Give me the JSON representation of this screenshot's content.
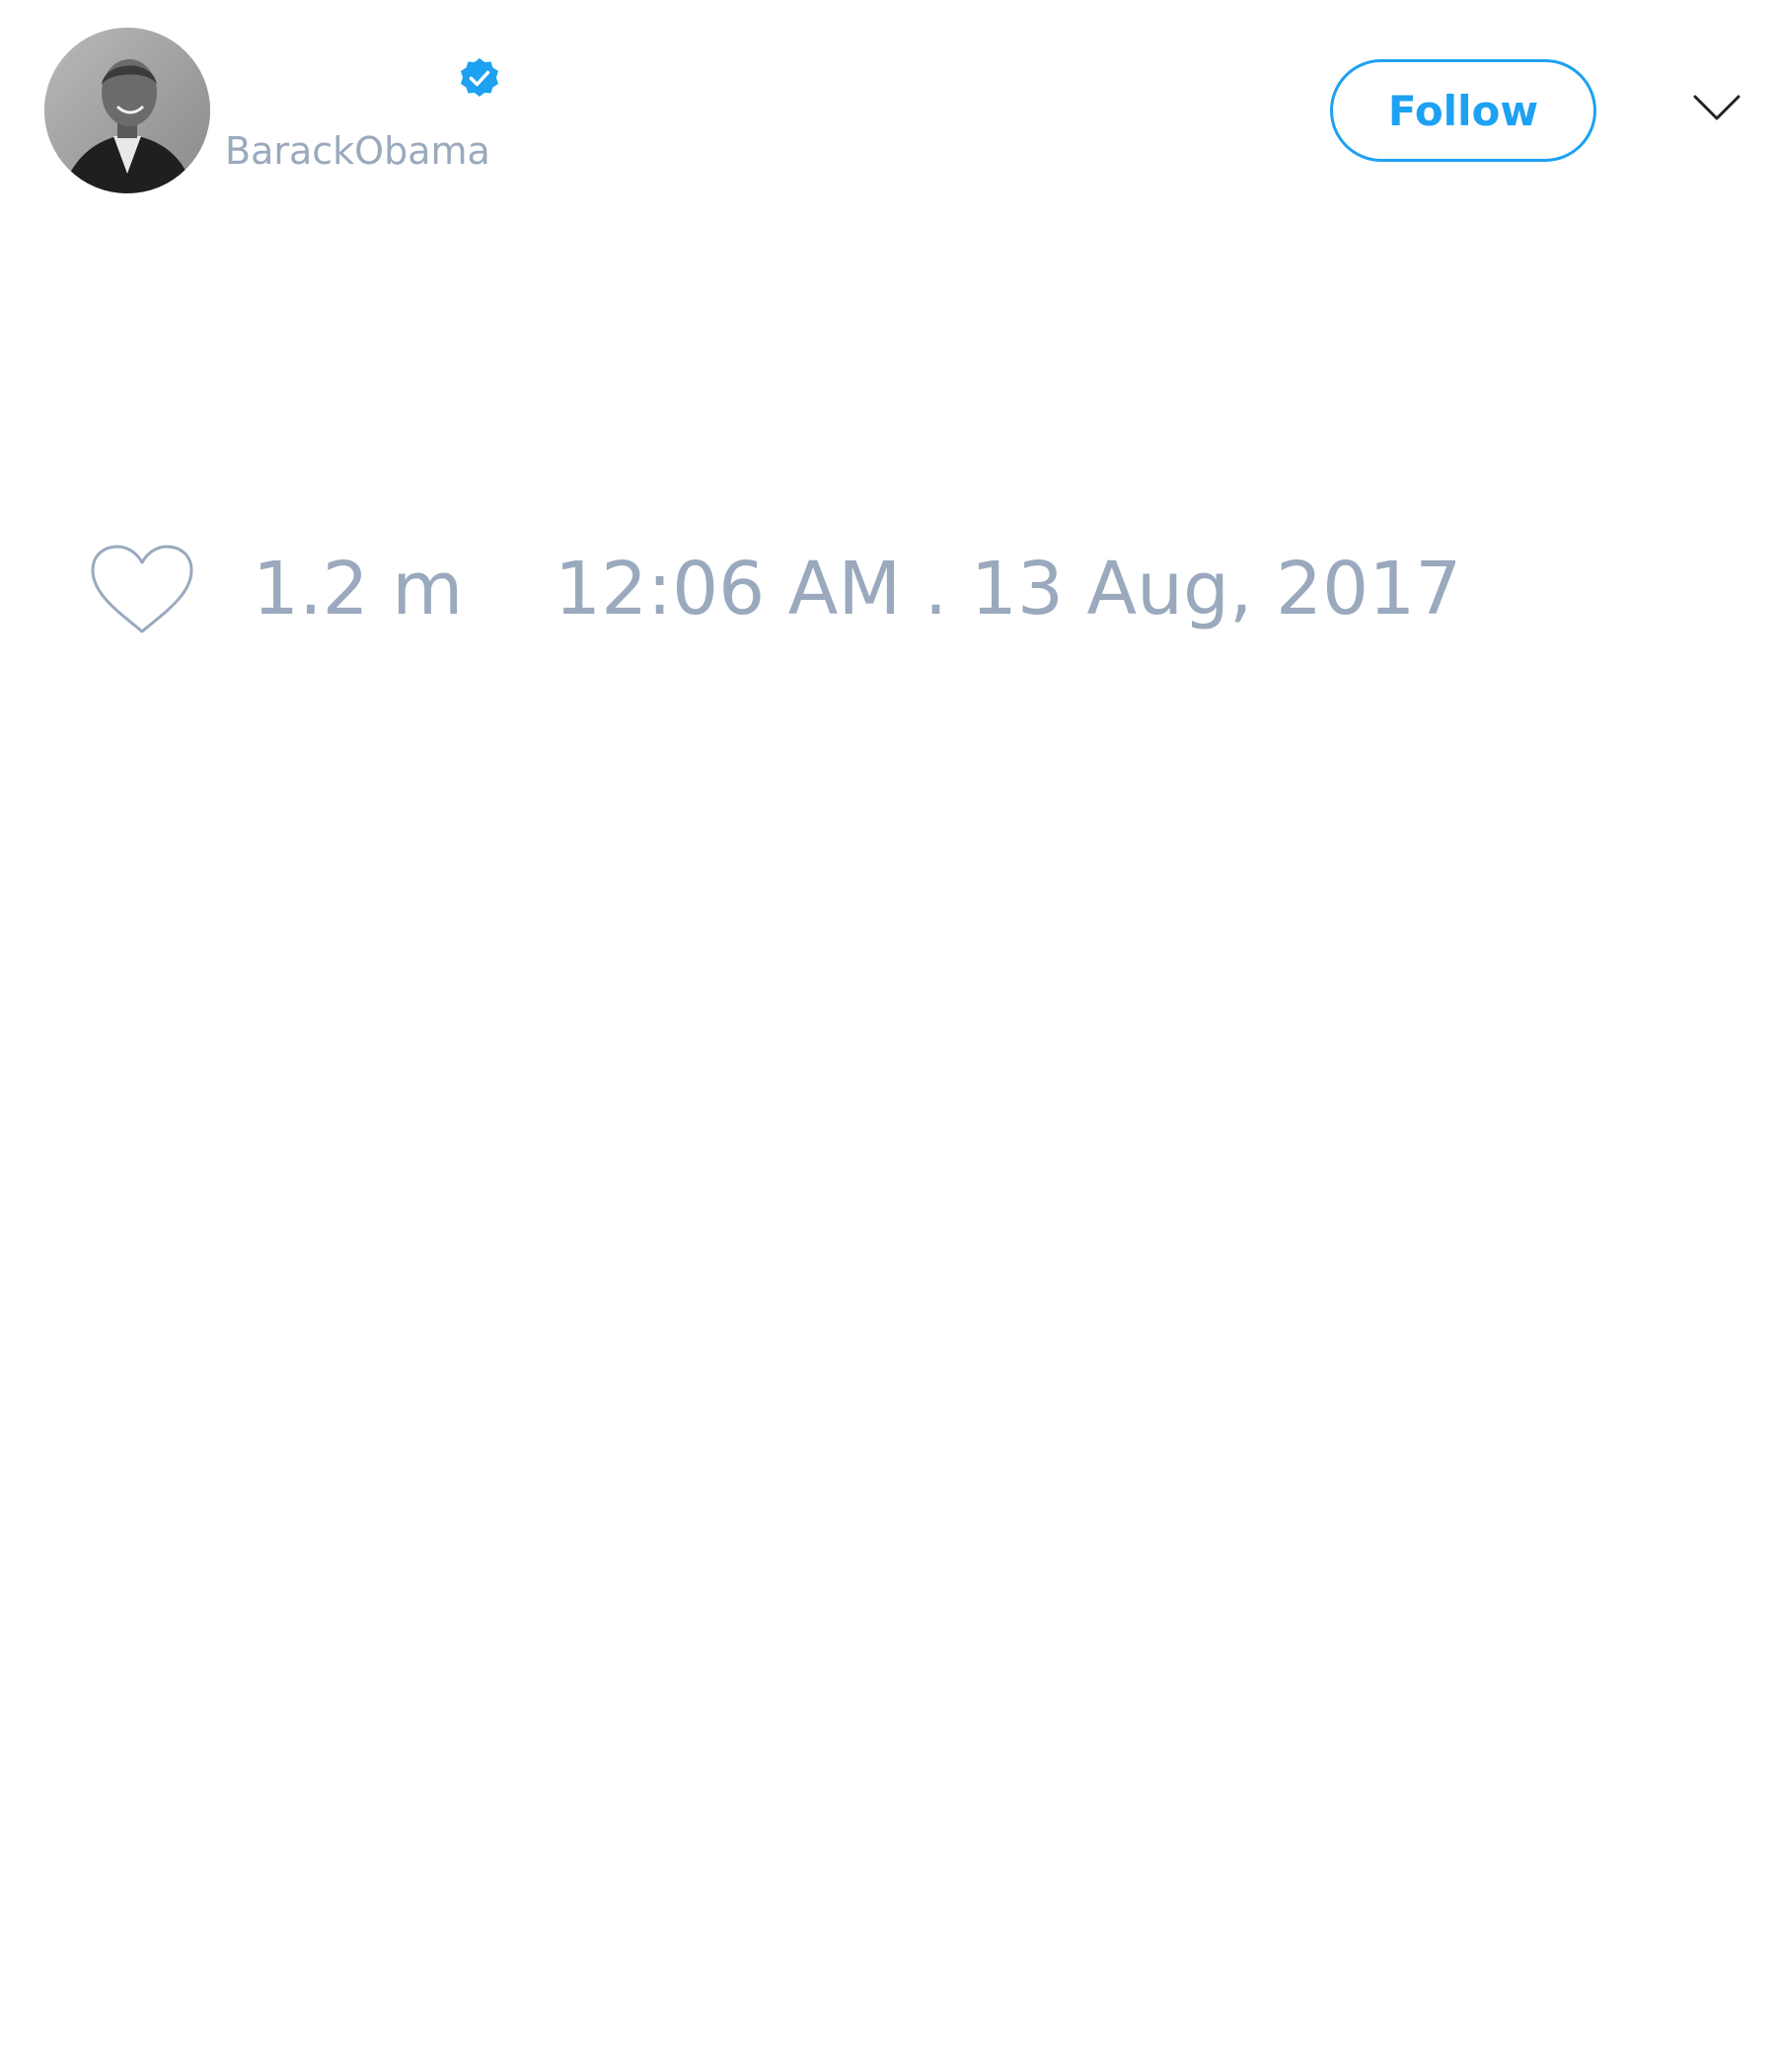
{
  "tweet": {
    "author": {
      "username": "BarackObama",
      "verified": true
    },
    "actions": {
      "follow_label": "Follow"
    },
    "stats": {
      "likes": "1.2 m",
      "timestamp": "12:06 AM . 13 Aug, 2017"
    }
  },
  "icons": {
    "verified": "verified-badge-icon",
    "menu": "chevron-down-icon",
    "like": "heart-icon"
  },
  "colors": {
    "accent": "#1da1f2",
    "muted_text": "#9aa9bd",
    "background": "#ffffff"
  }
}
